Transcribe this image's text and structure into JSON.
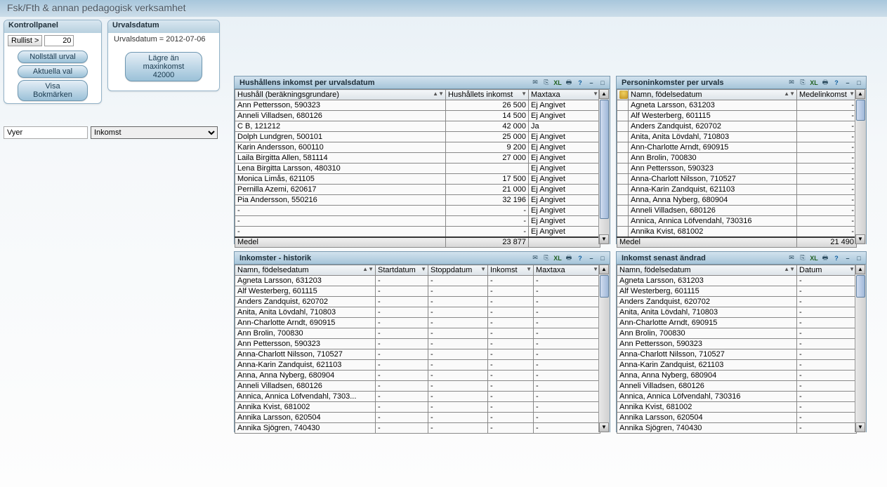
{
  "app": {
    "title": "Fsk/Fth & annan pedagogisk verksamhet"
  },
  "kontrollpanel": {
    "header": "Kontrollpanel",
    "rullist_label": "Rullist >",
    "rullist_value": "20",
    "btn_nollstall": "Nollställ urval",
    "btn_aktuella": "Aktuella val",
    "btn_bokmark": "Visa Bokmärken"
  },
  "urvalsdatum": {
    "header": "Urvalsdatum",
    "body": "Urvalsdatum  =  2012-07-06",
    "btn_line1": "Lägre än",
    "btn_line2": "maxinkomst 42000"
  },
  "vyer": {
    "label": "Vyer",
    "value": "Inkomst"
  },
  "panel_hushall": {
    "title": "Hushållens inkomst per urvalsdatum",
    "cols": [
      "Hushåll (beräkningsgrundare)",
      "Hushållets inkomst",
      "Maxtaxa"
    ],
    "rows": [
      [
        "Ann Pettersson, 590323",
        "26 500",
        "Ej Angivet"
      ],
      [
        "Anneli Villadsen, 680126",
        "14 500",
        "Ej Angivet"
      ],
      [
        "C B, 121212",
        "42 000",
        "Ja"
      ],
      [
        "Dolph Lundgren, 500101",
        "25 000",
        "Ej Angivet"
      ],
      [
        "Karin Andersson, 600110",
        "9 200",
        "Ej Angivet"
      ],
      [
        "Laila Birgitta Allen, 581114",
        "27 000",
        "Ej Angivet"
      ],
      [
        "Lena Birgitta Larsson, 480310",
        "",
        "Ej Angivet"
      ],
      [
        "Monica Limås, 621105",
        "17 500",
        "Ej Angivet"
      ],
      [
        "Pernilla Azemi, 620617",
        "21 000",
        "Ej Angivet"
      ],
      [
        "Pia Andersson, 550216",
        "32 196",
        "Ej Angivet"
      ],
      [
        "-",
        "-",
        "Ej Angivet"
      ],
      [
        "-",
        "-",
        "Ej Angivet"
      ],
      [
        "-",
        "-",
        "Ej Angivet"
      ]
    ],
    "footer": [
      "Medel",
      "23 877",
      ""
    ]
  },
  "panel_person": {
    "title": "Personinkomster per urvals",
    "cols": [
      "Namn, födelsedatum",
      "Medelinkomst"
    ],
    "rows": [
      [
        "Agneta Larsson, 631203",
        "-"
      ],
      [
        "Alf Westerberg, 601115",
        "-"
      ],
      [
        "Anders Zandquist, 620702",
        "-"
      ],
      [
        "Anita, Anita Lövdahl, 710803",
        "-"
      ],
      [
        "Ann-Charlotte Arndt, 690915",
        "-"
      ],
      [
        "Ann Brolin, 700830",
        "-"
      ],
      [
        "Ann Pettersson, 590323",
        "-"
      ],
      [
        "Anna-Charlott Nilsson, 710527",
        "-"
      ],
      [
        "Anna-Karin Zandquist, 621103",
        "-"
      ],
      [
        "Anna, Anna Nyberg, 680904",
        "-"
      ],
      [
        "Anneli Villadsen, 680126",
        "-"
      ],
      [
        "Annica, Annica Löfvendahl, 730316",
        "-"
      ],
      [
        "Annika Kvist, 681002",
        "-"
      ]
    ],
    "footer": [
      "Medel",
      "21 490"
    ]
  },
  "panel_historik": {
    "title": "Inkomster - historik",
    "cols": [
      "Namn, födelsedatum",
      "Startdatum",
      "Stoppdatum",
      "Inkomst",
      "Maxtaxa"
    ],
    "rows": [
      [
        "Agneta Larsson, 631203",
        "-",
        "-",
        "-",
        "-"
      ],
      [
        "Alf Westerberg, 601115",
        "-",
        "-",
        "-",
        "-"
      ],
      [
        "Anders Zandquist, 620702",
        "-",
        "-",
        "-",
        "-"
      ],
      [
        "Anita, Anita Lövdahl, 710803",
        "-",
        "-",
        "-",
        "-"
      ],
      [
        "Ann-Charlotte Arndt, 690915",
        "-",
        "-",
        "-",
        "-"
      ],
      [
        "Ann Brolin, 700830",
        "-",
        "-",
        "-",
        "-"
      ],
      [
        "Ann Pettersson, 590323",
        "-",
        "-",
        "-",
        "-"
      ],
      [
        "Anna-Charlott Nilsson, 710527",
        "-",
        "-",
        "-",
        "-"
      ],
      [
        "Anna-Karin Zandquist, 621103",
        "-",
        "-",
        "-",
        "-"
      ],
      [
        "Anna, Anna Nyberg, 680904",
        "-",
        "-",
        "-",
        "-"
      ],
      [
        "Anneli Villadsen, 680126",
        "-",
        "-",
        "-",
        "-"
      ],
      [
        "Annica, Annica Löfvendahl, 7303...",
        "-",
        "-",
        "-",
        "-"
      ],
      [
        "Annika Kvist, 681002",
        "-",
        "-",
        "-",
        "-"
      ],
      [
        "Annika Larsson, 620504",
        "-",
        "-",
        "-",
        "-"
      ],
      [
        "Annika Sjögren, 740430",
        "-",
        "-",
        "-",
        "-"
      ]
    ]
  },
  "panel_andrad": {
    "title": "Inkomst senast ändrad",
    "cols": [
      "Namn, födelsedatum",
      "Datum"
    ],
    "rows": [
      [
        "Agneta Larsson, 631203",
        "-"
      ],
      [
        "Alf Westerberg, 601115",
        "-"
      ],
      [
        "Anders Zandquist, 620702",
        "-"
      ],
      [
        "Anita, Anita Lövdahl, 710803",
        "-"
      ],
      [
        "Ann-Charlotte Arndt, 690915",
        "-"
      ],
      [
        "Ann Brolin, 700830",
        "-"
      ],
      [
        "Ann Pettersson, 590323",
        "-"
      ],
      [
        "Anna-Charlott Nilsson, 710527",
        "-"
      ],
      [
        "Anna-Karin Zandquist, 621103",
        "-"
      ],
      [
        "Anna, Anna Nyberg, 680904",
        "-"
      ],
      [
        "Anneli Villadsen, 680126",
        "-"
      ],
      [
        "Annica, Annica Löfvendahl, 730316",
        "-"
      ],
      [
        "Annika Kvist, 681002",
        "-"
      ],
      [
        "Annika Larsson, 620504",
        "-"
      ],
      [
        "Annika Sjögren, 740430",
        "-"
      ]
    ]
  },
  "icons": {
    "xl": "XL",
    "help": "?",
    "minus": "–",
    "close": "□",
    "sort": "▼",
    "sort_asc": "▲▼",
    "up": "▲",
    "down": "▼"
  }
}
